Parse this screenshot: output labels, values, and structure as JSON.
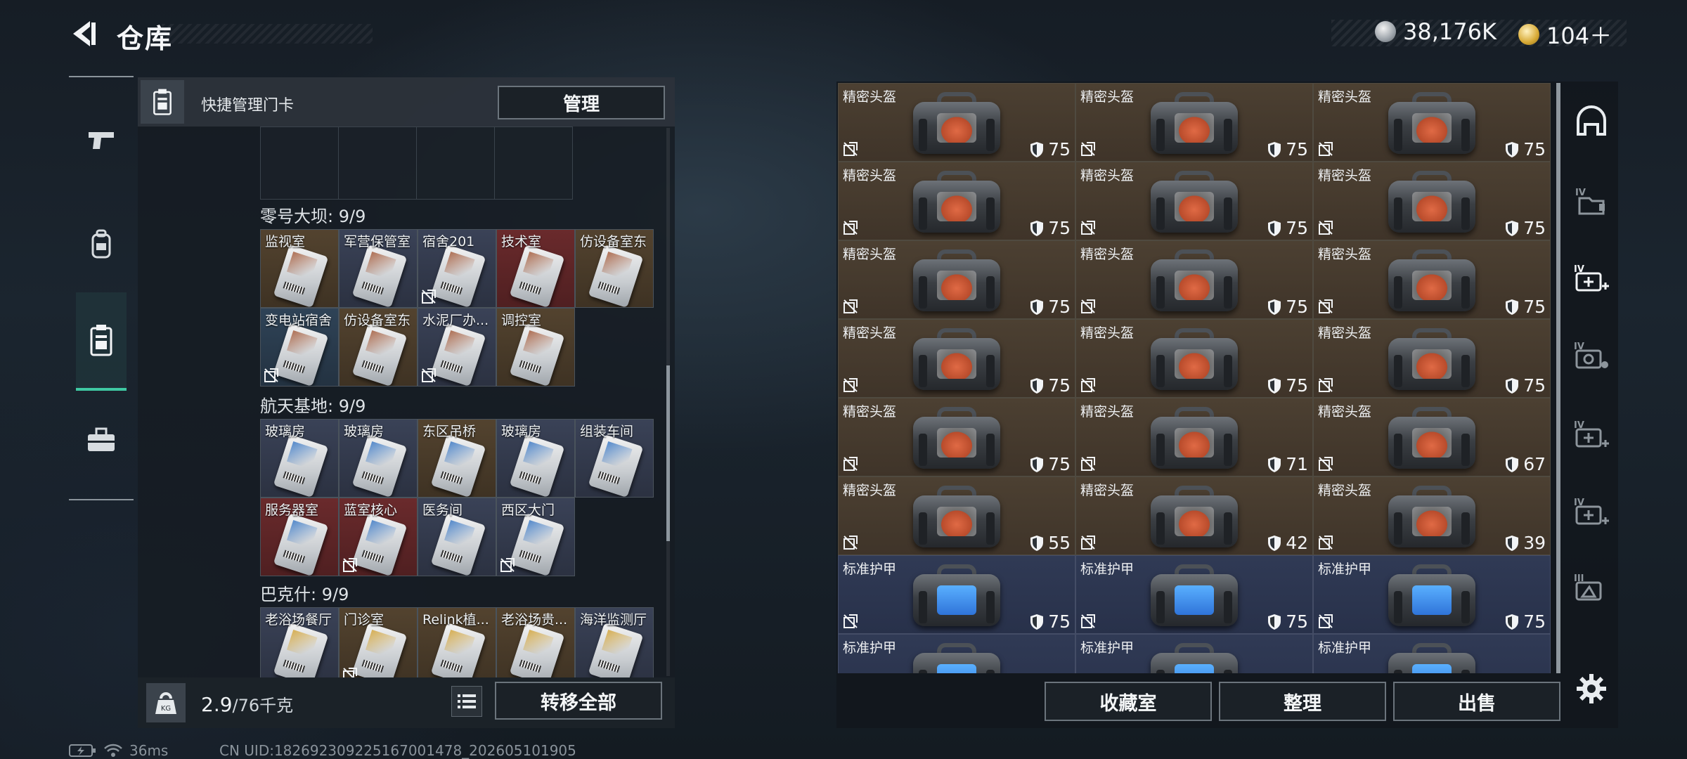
{
  "header": {
    "title": "仓库",
    "currencies": [
      {
        "icon": "silver-coin-icon",
        "value": "38,176K"
      },
      {
        "icon": "gold-coin-icon",
        "value": "104＋"
      }
    ]
  },
  "categories": [
    {
      "name": "weapon",
      "icon": "pistol-icon"
    },
    {
      "name": "equipment",
      "icon": "backpack-icon"
    },
    {
      "name": "keycards",
      "icon": "keycard-icon",
      "active": true
    },
    {
      "name": "misc",
      "icon": "toolbox-icon"
    }
  ],
  "quick": {
    "label": "快捷管理门卡",
    "manage_label": "管理"
  },
  "groups": [
    {
      "title": "零号大坝: 9/9",
      "stripe": "#a35a3a",
      "cards": [
        {
          "label": "监视室",
          "bg": "#53432f",
          "nolink": false
        },
        {
          "label": "军营保管室",
          "bg": "#3a4257",
          "nolink": false
        },
        {
          "label": "宿舍201",
          "bg": "#3a4257",
          "nolink": true
        },
        {
          "label": "技术室",
          "bg": "#6a2a2c",
          "nolink": false
        },
        {
          "label": "仿设备室东",
          "bg": "#53432f",
          "nolink": false
        },
        {
          "label": "变电站宿舍",
          "bg": "#2f4357",
          "nolink": true
        },
        {
          "label": "仿设备室东",
          "bg": "#53432f",
          "nolink": false
        },
        {
          "label": "水泥厂办...",
          "bg": "#3a4257",
          "nolink": true
        },
        {
          "label": "调控室",
          "bg": "#53432f",
          "nolink": false
        }
      ]
    },
    {
      "title": "航天基地: 9/9",
      "stripe": "#3a78c4",
      "cards": [
        {
          "label": "玻璃房",
          "bg": "#3a4257",
          "nolink": false
        },
        {
          "label": "玻璃房",
          "bg": "#3a4257",
          "nolink": false
        },
        {
          "label": "东区吊桥",
          "bg": "#53432f",
          "nolink": false
        },
        {
          "label": "玻璃房",
          "bg": "#3a4257",
          "nolink": false
        },
        {
          "label": "组装车间",
          "bg": "#3a4257",
          "nolink": false
        },
        {
          "label": "服务器室",
          "bg": "#6a2a2c",
          "nolink": false
        },
        {
          "label": "蓝室核心",
          "bg": "#6a2a2c",
          "nolink": true
        },
        {
          "label": "医务间",
          "bg": "#3a4257",
          "nolink": false
        },
        {
          "label": "西区大门",
          "bg": "#3a4257",
          "nolink": true
        }
      ]
    },
    {
      "title": "巴克什: 9/9",
      "stripe": "#d2a43a",
      "cards": [
        {
          "label": "老浴场餐厅",
          "bg": "#3a4257",
          "nolink": false
        },
        {
          "label": "门诊室",
          "bg": "#53432f",
          "nolink": true
        },
        {
          "label": "Relink植...",
          "bg": "#53432f",
          "nolink": false
        },
        {
          "label": "老浴场贵...",
          "bg": "#53432f",
          "nolink": false
        },
        {
          "label": "海洋监测厅",
          "bg": "#3a4257",
          "nolink": false
        }
      ]
    }
  ],
  "bottom": {
    "weight_current": "2.9",
    "weight_max": "/76千克",
    "transfer_label": "转移全部"
  },
  "items": [
    {
      "name": "精密头盔",
      "type": "helmet",
      "durability": "75"
    },
    {
      "name": "精密头盔",
      "type": "helmet",
      "durability": "75"
    },
    {
      "name": "精密头盔",
      "type": "helmet",
      "durability": "75"
    },
    {
      "name": "精密头盔",
      "type": "helmet",
      "durability": "75"
    },
    {
      "name": "精密头盔",
      "type": "helmet",
      "durability": "75"
    },
    {
      "name": "精密头盔",
      "type": "helmet",
      "durability": "75"
    },
    {
      "name": "精密头盔",
      "type": "helmet",
      "durability": "75"
    },
    {
      "name": "精密头盔",
      "type": "helmet",
      "durability": "75"
    },
    {
      "name": "精密头盔",
      "type": "helmet",
      "durability": "75"
    },
    {
      "name": "精密头盔",
      "type": "helmet",
      "durability": "75"
    },
    {
      "name": "精密头盔",
      "type": "helmet",
      "durability": "75"
    },
    {
      "name": "精密头盔",
      "type": "helmet",
      "durability": "75"
    },
    {
      "name": "精密头盔",
      "type": "helmet",
      "durability": "75"
    },
    {
      "name": "精密头盔",
      "type": "helmet",
      "durability": "71"
    },
    {
      "name": "精密头盔",
      "type": "helmet",
      "durability": "67"
    },
    {
      "name": "精密头盔",
      "type": "helmet",
      "durability": "55"
    },
    {
      "name": "精密头盔",
      "type": "helmet",
      "durability": "42"
    },
    {
      "name": "精密头盔",
      "type": "helmet",
      "durability": "39"
    },
    {
      "name": "标准护甲",
      "type": "armor",
      "durability": "75"
    },
    {
      "name": "标准护甲",
      "type": "armor",
      "durability": "75"
    },
    {
      "name": "标准护甲",
      "type": "armor",
      "durability": "75"
    },
    {
      "name": "标准护甲",
      "type": "armor",
      "durability": ""
    },
    {
      "name": "标准护甲",
      "type": "armor",
      "durability": ""
    },
    {
      "name": "标准护甲",
      "type": "armor",
      "durability": ""
    }
  ],
  "side_tabs": [
    "helmet-tab-icon",
    "storage-iv-icon",
    "storage-iv-add-icon",
    "storage-iv-camera-icon",
    "storage-iv-plus-icon",
    "storage-iv-plus-icon-2",
    "storage-iii-icon"
  ],
  "actions": {
    "collection_label": "收藏室",
    "sort_label": "整理",
    "sell_label": "出售"
  },
  "status": {
    "ping": "36ms",
    "uid": "CN UID:18269230922516700147​8_202605101905"
  }
}
